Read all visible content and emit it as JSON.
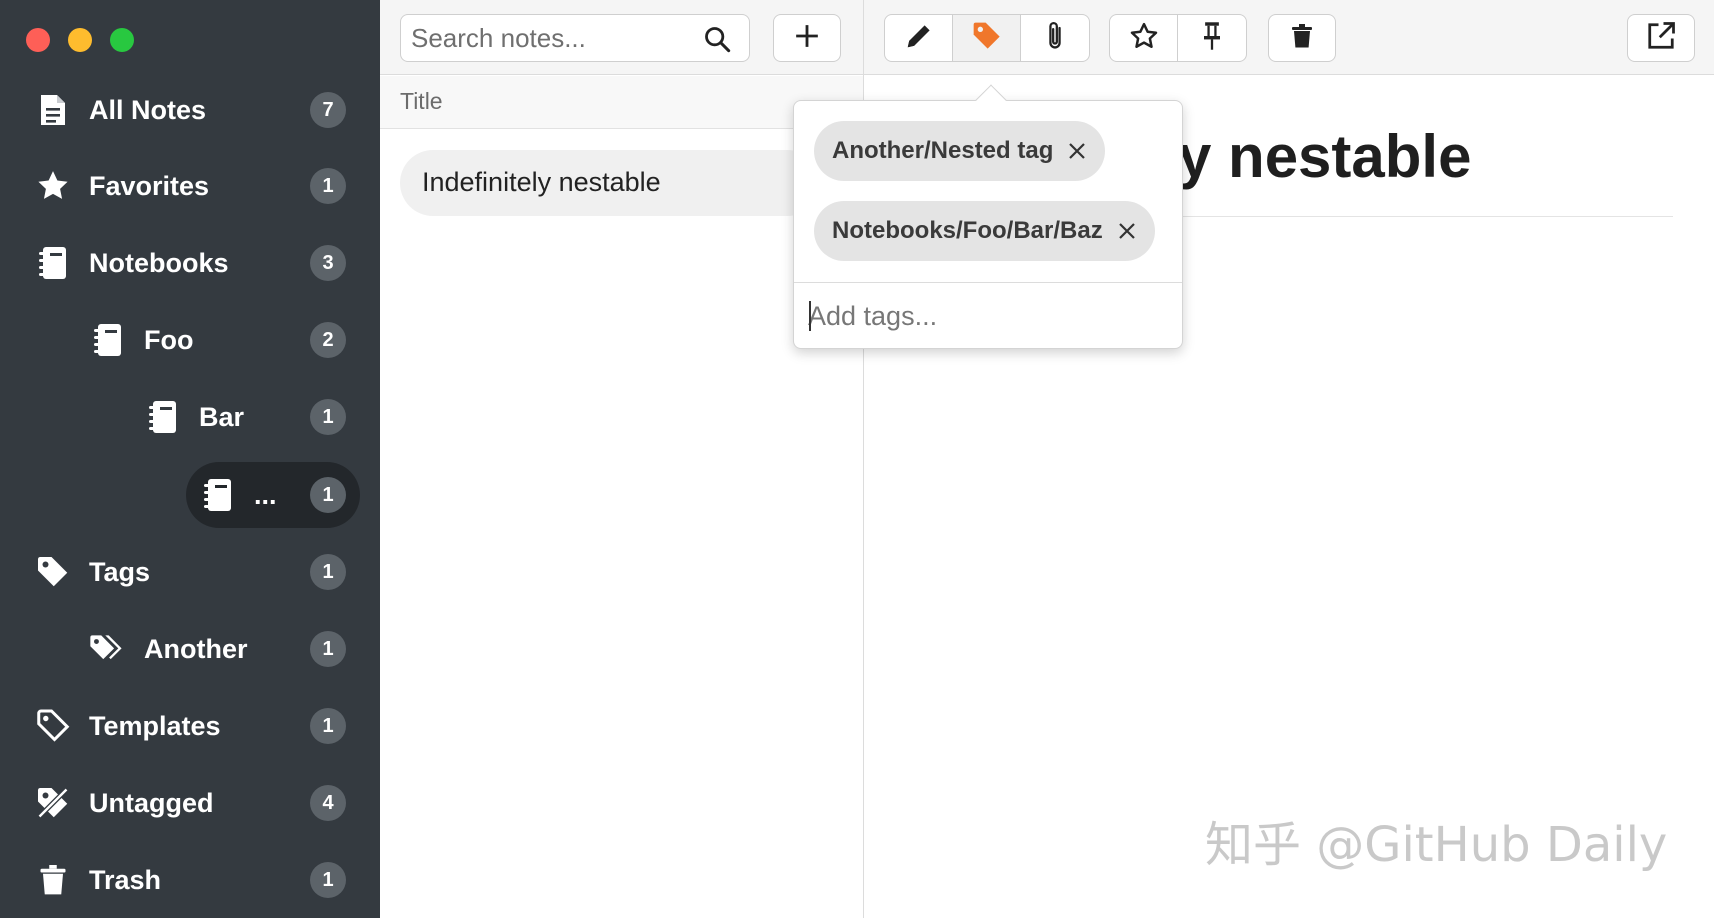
{
  "sidebar": {
    "items": [
      {
        "label": "All Notes",
        "count": "7",
        "icon": "note-icon"
      },
      {
        "label": "Favorites",
        "count": "1",
        "icon": "star-icon"
      },
      {
        "label": "Notebooks",
        "count": "3",
        "icon": "notebook-icon"
      },
      {
        "label": "Foo",
        "count": "2",
        "icon": "notebook-icon"
      },
      {
        "label": "Bar",
        "count": "1",
        "icon": "notebook-icon"
      },
      {
        "label": "...",
        "count": "1",
        "icon": "notebook-icon",
        "active": true
      },
      {
        "label": "Tags",
        "count": "1",
        "icon": "tag-icon"
      },
      {
        "label": "Another",
        "count": "1",
        "icon": "tags-icon"
      },
      {
        "label": "Templates",
        "count": "1",
        "icon": "template-icon"
      },
      {
        "label": "Untagged",
        "count": "4",
        "icon": "untagged-icon"
      },
      {
        "label": "Trash",
        "count": "1",
        "icon": "trash-icon"
      }
    ]
  },
  "search": {
    "placeholder": "Search notes..."
  },
  "toolbar": {
    "accent": "#f0772b",
    "buttons": [
      "new-note",
      "edit",
      "tags",
      "attachment",
      "favorite",
      "pin",
      "delete",
      "open-external"
    ]
  },
  "list": {
    "header": "Title",
    "notes": [
      {
        "title": "Indefinitely nestable"
      }
    ]
  },
  "editor": {
    "title_visible": "y nestable"
  },
  "tag_popover": {
    "tags": [
      "Another/Nested tag",
      "Notebooks/Foo/Bar/Baz"
    ],
    "placeholder": "Add tags..."
  },
  "watermark": "知乎 @GitHub Daily"
}
